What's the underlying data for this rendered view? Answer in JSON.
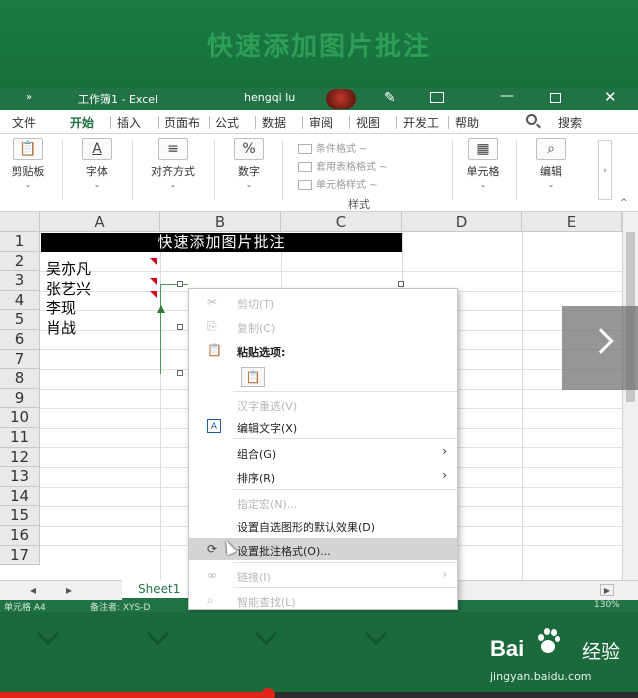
{
  "banner": {
    "title": "快速添加图片批注"
  },
  "titlebar": {
    "chevron": "»",
    "title": "工作簿1  -  Excel",
    "user": "hengqi lu",
    "minimize": "—",
    "close": "✕"
  },
  "tabs": {
    "items": [
      "文件",
      "开始",
      "插入",
      "页面布",
      "公式",
      "数据",
      "审阅",
      "视图",
      "开发工",
      "帮助"
    ],
    "active": "开始",
    "search": "搜索"
  },
  "ribbon": {
    "clipboard": "剪贴板",
    "font": "字体",
    "alignment": "对齐方式",
    "number": "数字",
    "number_icon": "%",
    "conditional_format": "条件格式 ~",
    "table_format": "套用表格格式 ~",
    "cell_styles": "单元格样式 ~",
    "styles_group": "样式",
    "cells": "单元格",
    "editing": "编辑",
    "caret": "⌄"
  },
  "grid": {
    "columns": [
      "A",
      "B",
      "C",
      "D",
      "E"
    ],
    "rows": [
      "1",
      "2",
      "3",
      "4",
      "5",
      "6",
      "7",
      "8",
      "9",
      "10",
      "11",
      "12",
      "13",
      "14",
      "15",
      "16",
      "17"
    ],
    "header_cell": "快速添加图片批注",
    "cells": [
      "吴亦凡",
      "张艺兴",
      "李现",
      "肖战"
    ]
  },
  "sheetbar": {
    "sheet": "Sheet1",
    "scroll_right": "▶"
  },
  "statusbar": {
    "ready": "单元格 A4",
    "comment": "备注者: XYS-D",
    "zoom": "130%"
  },
  "menu": {
    "cut": "剪切(T)",
    "copy": "复制(C)",
    "paste_options": "粘贴选项:",
    "reconvert": "汉字重选(V)",
    "edit_text": "编辑文字(X)",
    "group": "组合(G)",
    "order": "排序(R)",
    "assign_macro": "指定宏(N)...",
    "set_default": "设置自选图形的默认效果(D)",
    "format_comment": "设置批注格式(O)...",
    "link": "链接(I)",
    "smart_lookup": "智能查找(L)",
    "arrow": "›"
  },
  "footer": {
    "brand": "Bai",
    "brand2": "经验",
    "url": "jingyan.baidu.com"
  },
  "progress": {
    "fraction": 0.42
  },
  "colors": {
    "excel_green": "#217346",
    "banner_green": "#1b7a44",
    "progress_red": "#e2231a"
  }
}
